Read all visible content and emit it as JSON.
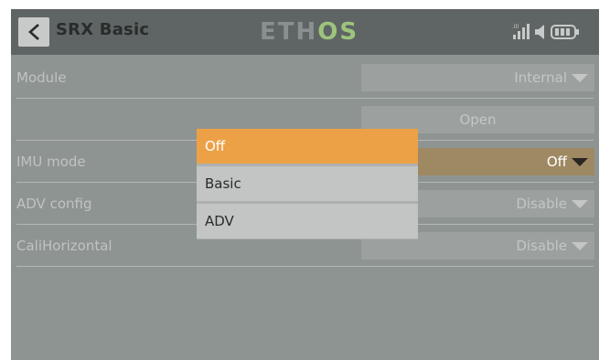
{
  "header": {
    "title": "SRX Basic",
    "logo_part1": "ETH",
    "logo_part2": "OS"
  },
  "rows": [
    {
      "label": "Module",
      "value": "Internal"
    },
    {
      "label": "",
      "value": "Open"
    },
    {
      "label": "IMU mode",
      "value": "Off"
    },
    {
      "label": "ADV config",
      "value": "Disable"
    },
    {
      "label": "CaliHorizontal",
      "value": "Disable"
    }
  ],
  "popup": {
    "options": [
      {
        "label": "Off",
        "selected": true
      },
      {
        "label": "Basic",
        "selected": false
      },
      {
        "label": "ADV",
        "selected": false
      }
    ]
  },
  "colors": {
    "accent": "#eca146",
    "header_bg": "#5f6564",
    "screen_bg": "#8e9492"
  }
}
